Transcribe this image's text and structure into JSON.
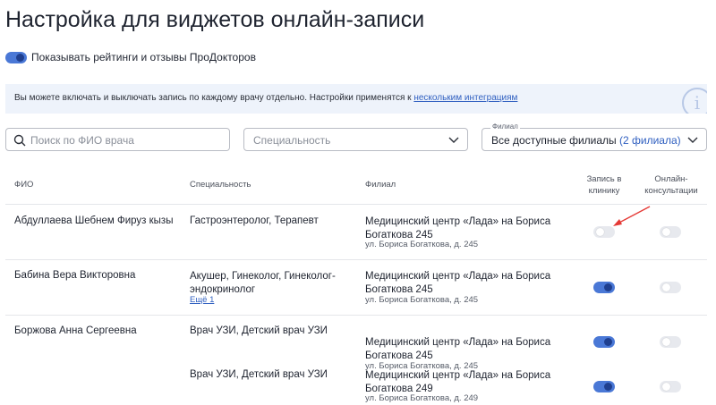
{
  "page_title": "Настройка для виджетов онлайн-записи",
  "show_ratings": {
    "label": "Показывать рейтинги и отзывы ПроДокторов",
    "enabled": true
  },
  "info_banner": {
    "text": "Вы можете включать и выключать запись по каждому врачу отдельно. Настройки применятся к ",
    "link": "нескольким интеграциям"
  },
  "filters": {
    "search_placeholder": "Поиск по ФИО врача",
    "specialty_placeholder": "Специальность",
    "filial_label": "Филиал",
    "filial_value": "Все доступные филиалы",
    "filial_count": "(2 филиала)"
  },
  "table": {
    "headers": {
      "fio": "ФИО",
      "specialty": "Специальность",
      "filial": "Филиал",
      "clinic": "Запись в клинику",
      "online": "Онлайн-консультации"
    },
    "rows": [
      {
        "name": "Абдуллаева Шебнем Фируз кызы",
        "specialty": "Гастроэнтеролог, Терапевт",
        "filial_name": "Медицинский центр «Лада» на Бориса Богаткова 245",
        "filial_address": "ул. Бориса Богаткова, д. 245",
        "clinic_enabled": false,
        "online_enabled": false
      },
      {
        "name": "Бабина Вера Викторовна",
        "specialty": "Акушер, Гинеколог, Гинеколог-эндокринолог",
        "more": "Ещё 1",
        "filial_name": "Медицинский центр «Лада» на Бориса Богаткова 245",
        "filial_address": "ул. Бориса Богаткова, д. 245",
        "clinic_enabled": true,
        "online_enabled": false
      },
      {
        "name": "Боржова Анна Сергеевна",
        "specialty": "Врач УЗИ, Детский врач УЗИ",
        "filial_name": "Медицинский центр «Лада» на Бориса Богаткова 245",
        "filial_address": "ул. Бориса Богаткова, д. 245",
        "clinic_enabled": true,
        "online_enabled": false
      },
      {
        "specialty": "Врач УЗИ, Детский врач УЗИ",
        "filial_name": "Медицинский центр «Лада» на Бориса Богаткова 249",
        "filial_address": "ул. Бориса Богаткова, д. 249",
        "clinic_enabled": true,
        "online_enabled": false
      }
    ]
  },
  "colors": {
    "accent": "#4a78d6",
    "toggle_off": "#e7e9ee",
    "banner_bg": "#eef3fb",
    "arrow": "#e53935"
  },
  "icons": {
    "search": "search-icon",
    "chevron": "chevron-down-icon",
    "info": "info-icon"
  }
}
